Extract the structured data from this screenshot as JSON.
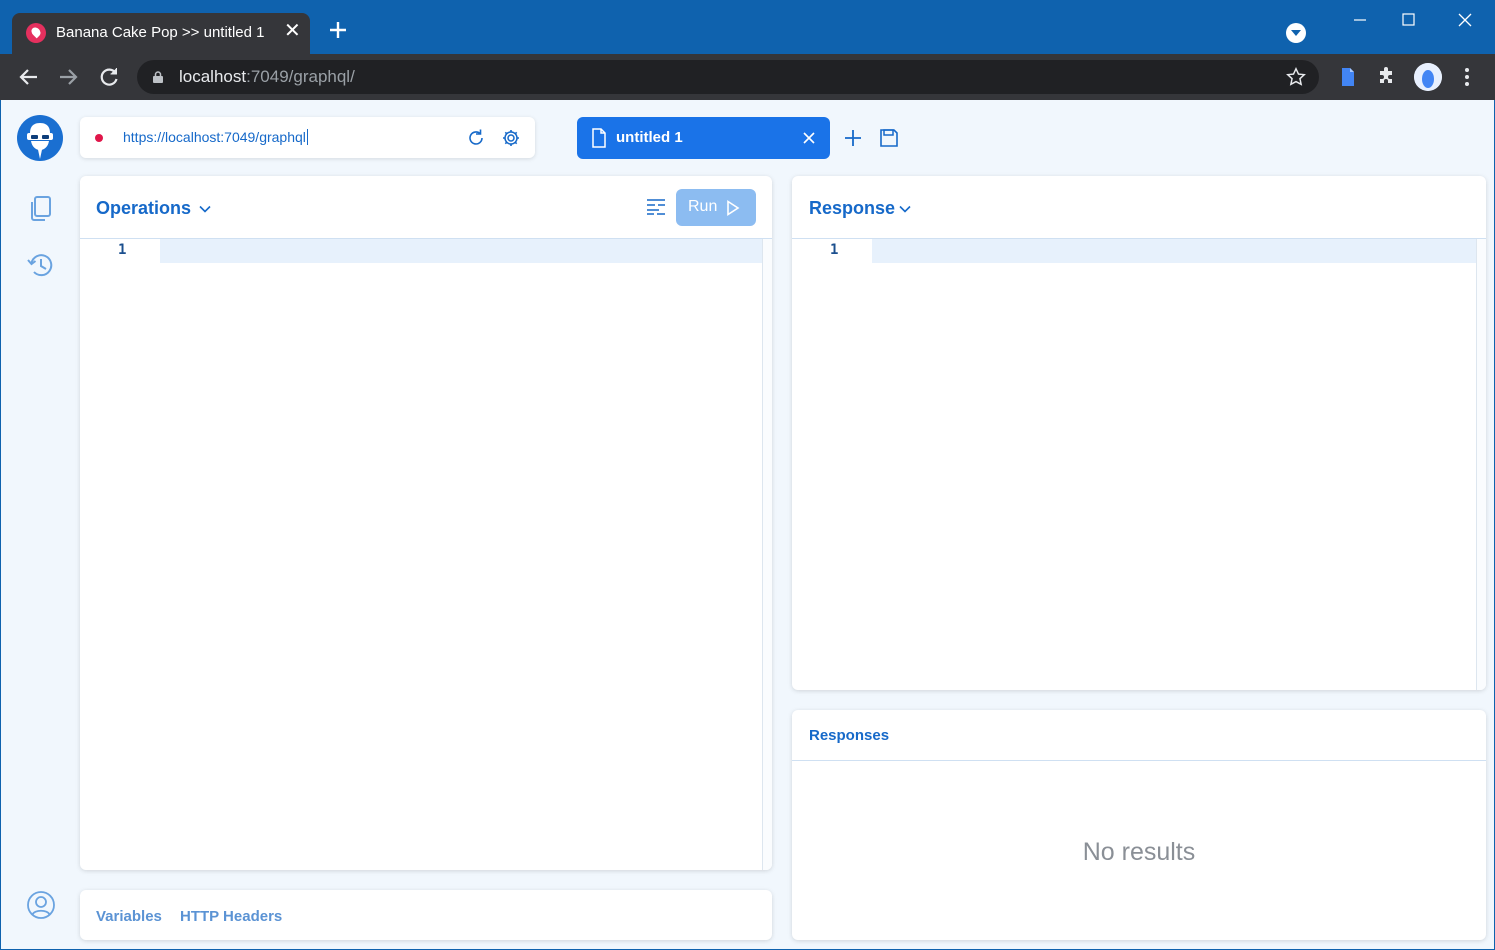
{
  "browser": {
    "tab_title": "Banana Cake Pop >> untitled 1",
    "tab_close": "✕",
    "url_host": "localhost",
    "url_rest": ":7049/graphql/"
  },
  "connection": {
    "endpoint": "https://localhost:7049/graphql",
    "status_color": "#e0164a"
  },
  "document_tab": {
    "label": "untitled 1"
  },
  "operations": {
    "title": "Operations",
    "run_label": "Run",
    "line_number": "1"
  },
  "response": {
    "title": "Response",
    "line_number": "1"
  },
  "responses": {
    "title": "Responses",
    "empty_text": "No results"
  },
  "bottom_tabs": {
    "variables": "Variables",
    "http_headers": "HTTP Headers"
  },
  "colors": {
    "accent": "#1a73e8",
    "titlebar": "#0f62ae",
    "run_disabled": "#8cbcf1"
  },
  "icons": {
    "sidebar": [
      "documents-icon",
      "history-icon",
      "account-icon"
    ]
  }
}
